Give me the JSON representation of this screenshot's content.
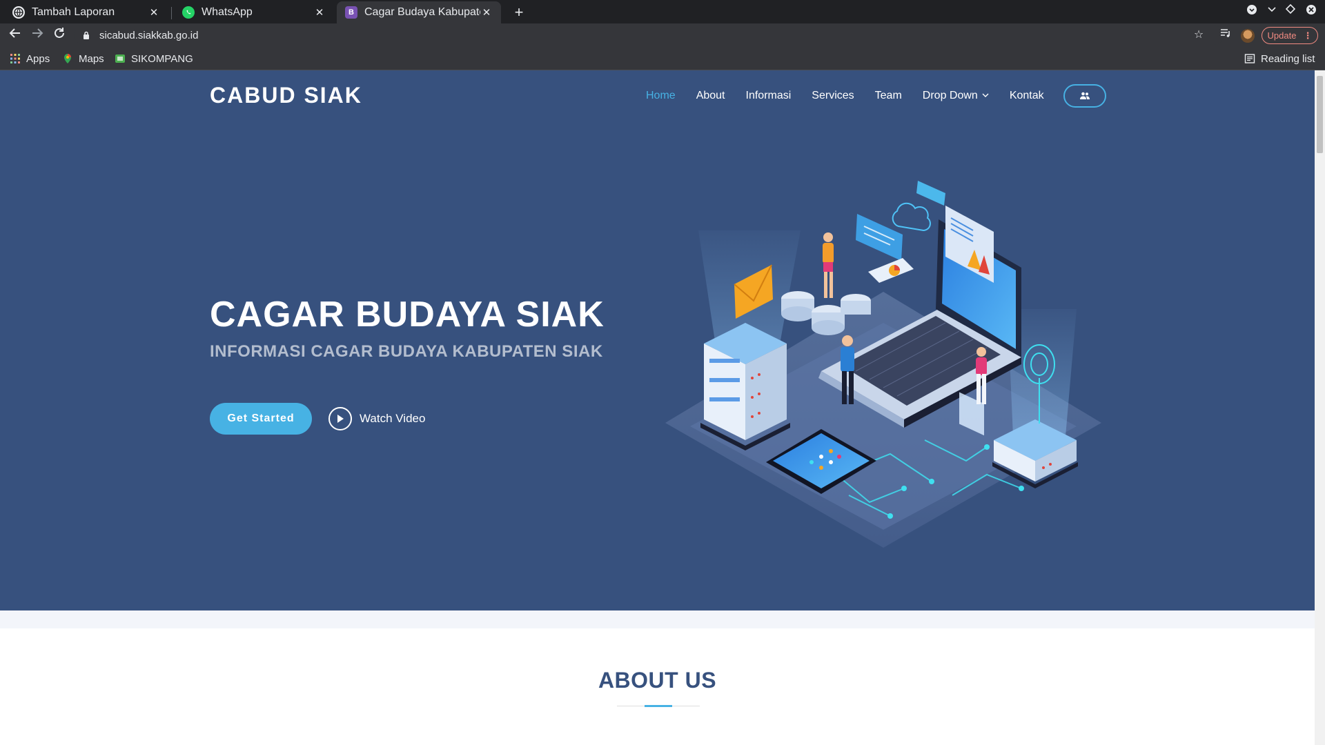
{
  "browser": {
    "tabs": [
      {
        "title": "Tambah Laporan",
        "icon": "globe-icon",
        "active": false
      },
      {
        "title": "WhatsApp",
        "icon": "whatsapp-icon",
        "active": false
      },
      {
        "title": "Cagar Budaya Kabupaten",
        "icon": "bootstrap-icon",
        "active": true
      }
    ],
    "new_tab_label": "+",
    "url": "sicabud.siakkab.go.id",
    "update_label": "Update",
    "bookmarks": [
      {
        "label": "Apps",
        "icon": "apps-grid-icon"
      },
      {
        "label": "Maps",
        "icon": "maps-pin-icon"
      },
      {
        "label": "SIKOMPANG",
        "icon": "sikompang-icon"
      }
    ],
    "reading_list_label": "Reading list"
  },
  "site": {
    "brand": "CABUD SIAK",
    "nav": [
      {
        "label": "Home",
        "active": true
      },
      {
        "label": "About"
      },
      {
        "label": "Informasi"
      },
      {
        "label": "Services"
      },
      {
        "label": "Team"
      },
      {
        "label": "Drop Down",
        "dropdown": true
      },
      {
        "label": "Kontak"
      }
    ],
    "login_icon": "users-icon",
    "hero": {
      "title": "CAGAR BUDAYA SIAK",
      "subtitle": "INFORMASI CAGAR BUDAYA KABUPATEN SIAK",
      "cta_label": "Get Started",
      "video_label": "Watch Video"
    },
    "about": {
      "title": "ABOUT US"
    },
    "colors": {
      "hero_bg": "#37517e",
      "accent": "#47b2e4"
    }
  }
}
